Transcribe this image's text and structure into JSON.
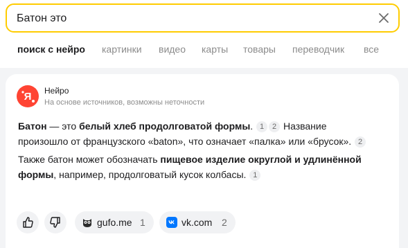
{
  "search": {
    "value": "Батон это"
  },
  "tabs": [
    {
      "label": "поиск с нейро"
    },
    {
      "label": "картинки"
    },
    {
      "label": "видео"
    },
    {
      "label": "карты"
    },
    {
      "label": "товары"
    },
    {
      "label": "переводчик"
    },
    {
      "label": "все"
    }
  ],
  "card": {
    "source_title": "Нейро",
    "source_subtitle": "На основе источников, возможны неточности",
    "p1": {
      "t1": "Батон",
      "t2": " — это ",
      "t3": "белый хлеб продолговатой формы",
      "t4": ".",
      "refs_a": [
        "1",
        "2"
      ],
      "t5": "Название произошло от французского «baton», что означает «палка» или «брусок».",
      "refs_b": [
        "2"
      ]
    },
    "p2": {
      "t1": "Также батон может обозначать ",
      "t2": "пищевое изделие округлой и удлинённой формы",
      "t3": ", например, продолговатый кусок колбасы.",
      "refs": [
        "1"
      ]
    },
    "sources": [
      {
        "name": "gufo.me",
        "count": "1",
        "icon": "owl-icon"
      },
      {
        "name": "vk.com",
        "count": "2",
        "icon": "vk-icon",
        "color": "#0077ff"
      }
    ]
  },
  "colors": {
    "accent": "#ffcc00",
    "logo": "#ff4433",
    "vk": "#0077ff"
  }
}
